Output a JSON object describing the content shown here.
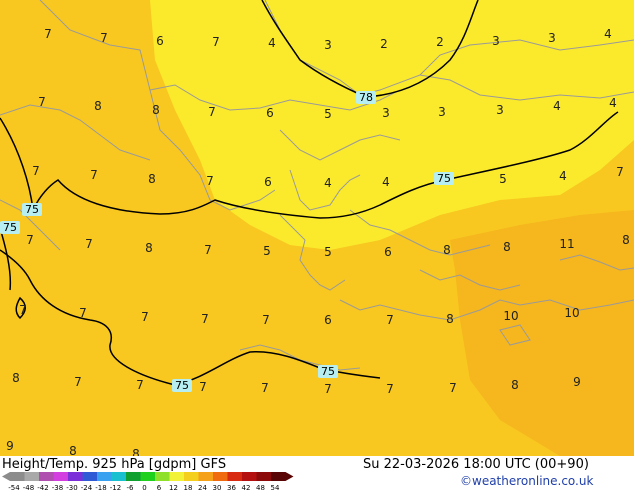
{
  "footer": {
    "title": "Height/Temp. 925 hPa [gdpm] GFS",
    "datetime": "Su 22-03-2026 18:00 UTC (00+90)",
    "credit": "©weatheronline.co.uk"
  },
  "colorbar": {
    "labels": [
      "-54",
      "-48",
      "-42",
      "-38",
      "-30",
      "-24",
      "-18",
      "-12",
      "-6",
      "0",
      "6",
      "12",
      "18",
      "24",
      "30",
      "36",
      "42",
      "48",
      "54"
    ],
    "colors": [
      "#8c8c8c",
      "#a9a9a9",
      "#b14fb1",
      "#d33ee0",
      "#7b2fd9",
      "#2f5ad6",
      "#3aa0f0",
      "#18c0d0",
      "#10a030",
      "#1fd01f",
      "#8fe02a",
      "#f2f239",
      "#f5cf1d",
      "#f5a21a",
      "#f06b10",
      "#d82a10",
      "#b41010",
      "#8c0a0a",
      "#5a0505"
    ]
  },
  "map": {
    "colors": {
      "base": "#f8c820",
      "light": "#fbea2c",
      "orange": "#f6b61e",
      "border": "#9a9a9a",
      "isohypse": "#000000",
      "label_bg": "#b6eef2"
    },
    "isohypse_labels": [
      "78",
      "75",
      "75",
      "75",
      "75",
      "75"
    ],
    "temperatures": [
      "7",
      "7",
      "6",
      "7",
      "4",
      "3",
      "2",
      "2",
      "3",
      "3",
      "4",
      "7",
      "8",
      "8",
      "7",
      "6",
      "5",
      "3",
      "3",
      "3",
      "4",
      "4",
      "7",
      "7",
      "8",
      "7",
      "6",
      "4",
      "4",
      "5",
      "4",
      "7",
      "7",
      "7",
      "8",
      "7",
      "5",
      "5",
      "6",
      "8",
      "8",
      "11",
      "8",
      "7",
      "7",
      "7",
      "7",
      "7",
      "6",
      "7",
      "8",
      "10",
      "10",
      "8",
      "7",
      "7",
      "7",
      "7",
      "7",
      "7",
      "7",
      "8",
      "9",
      "9",
      "8",
      "8"
    ]
  }
}
